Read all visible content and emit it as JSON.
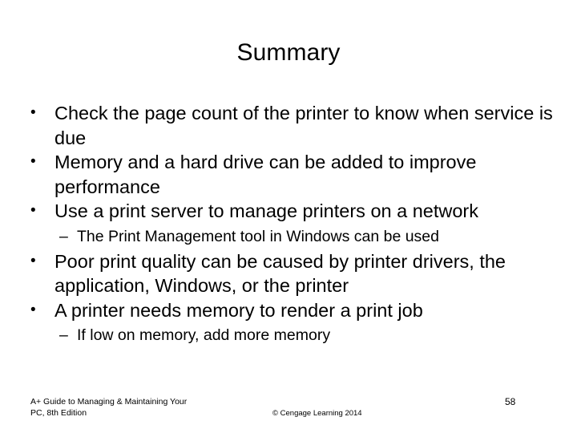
{
  "slide": {
    "title": "Summary",
    "page_number": "58",
    "background_color": "#ffffff",
    "text_color": "#000000",
    "bullets": [
      {
        "level": 1,
        "marker": "•",
        "text": "Check the page count of the printer to know when service is due"
      },
      {
        "level": 1,
        "marker": "•",
        "text": "Memory and a hard drive can be added to improve performance"
      },
      {
        "level": 1,
        "marker": "•",
        "text": "Use a print server to manage printers on a network"
      },
      {
        "level": 2,
        "marker": "–",
        "text": "The Print Management tool in Windows can be used"
      },
      {
        "level": 1,
        "marker": "•",
        "text": "Poor print quality can be caused by printer drivers, the application, Windows, or the printer"
      },
      {
        "level": 1,
        "marker": "•",
        "text": "A printer needs memory to render a print job"
      },
      {
        "level": 2,
        "marker": "–",
        "text": "If low on memory, add more memory"
      }
    ]
  },
  "footer": {
    "book_title_line1": "A+ Guide to Managing & Maintaining Your",
    "book_title_line2": "PC, 8th Edition",
    "copyright": "© Cengage Learning  2014"
  }
}
